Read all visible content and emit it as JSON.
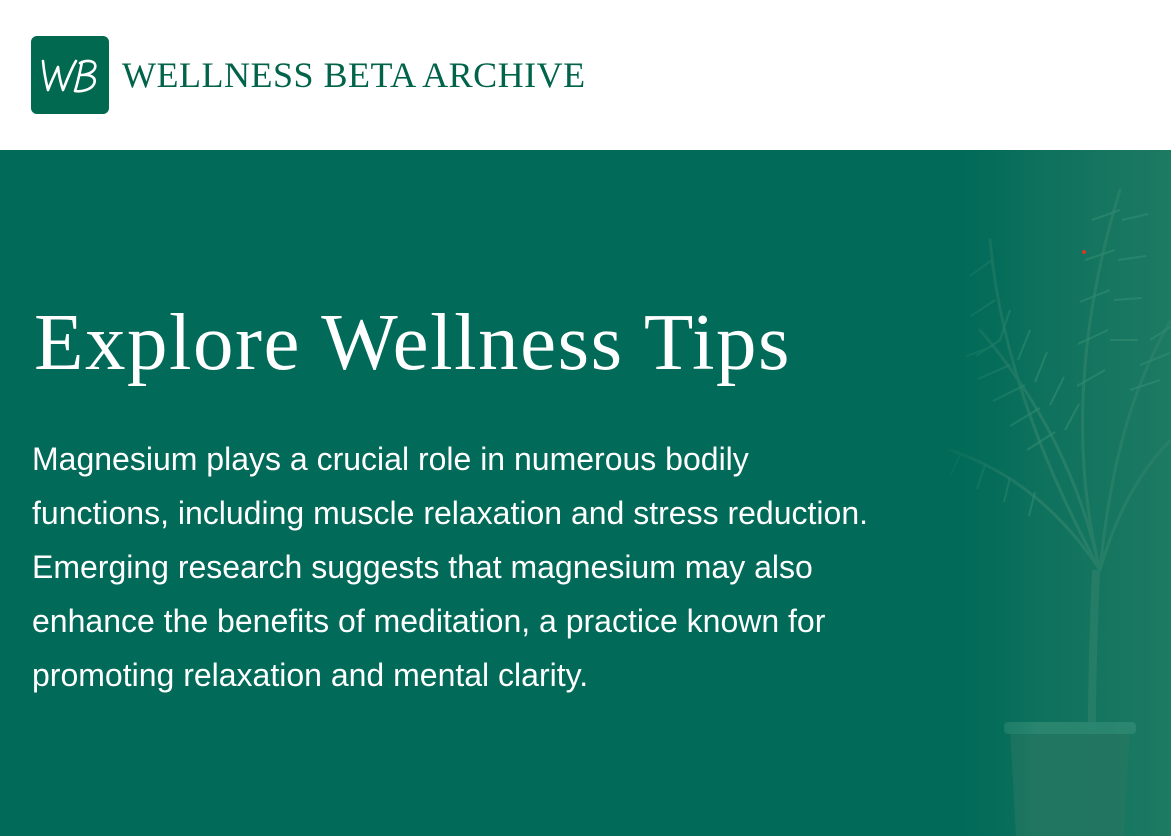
{
  "header": {
    "logo_monogram": "WB",
    "brand_name": "WELLNESS BETA ARCHIVE"
  },
  "hero": {
    "title": "Explore Wellness Tips",
    "body": "Magnesium plays a crucial role in numerous bodily functions, including muscle relaxation and stress reduction. Emerging research suggests that magnesium may also enhance the benefits of meditation, a practice known for promoting relaxation and mental clarity.",
    "background_image": "potted-palm-plant"
  },
  "colors": {
    "brand_green": "#00694f",
    "hero_background": "#016a58",
    "hero_text": "#ffffff",
    "header_background": "#ffffff"
  }
}
